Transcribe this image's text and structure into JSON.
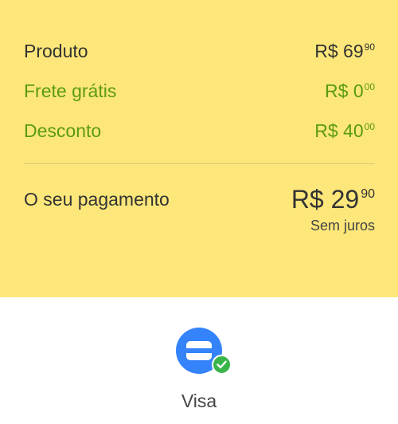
{
  "summary": {
    "product": {
      "label": "Produto",
      "amount": "R$ 69",
      "cents": "90"
    },
    "shipping": {
      "label": "Frete grátis",
      "amount": "R$ 0",
      "cents": "00"
    },
    "discount": {
      "label": "Desconto",
      "amount": "R$ 40",
      "cents": "00"
    },
    "payment": {
      "label": "O seu pagamento",
      "amount": "R$ 29",
      "cents": "90",
      "installments": "Sem juros"
    }
  },
  "payment_method": {
    "name": "Visa",
    "icon": "credit-card-icon",
    "badge_icon": "check-icon"
  },
  "colors": {
    "summary_background": "#fde77a",
    "accent_green": "#5b9a14",
    "icon_blue": "#3483fa",
    "check_green": "#39b54a"
  }
}
